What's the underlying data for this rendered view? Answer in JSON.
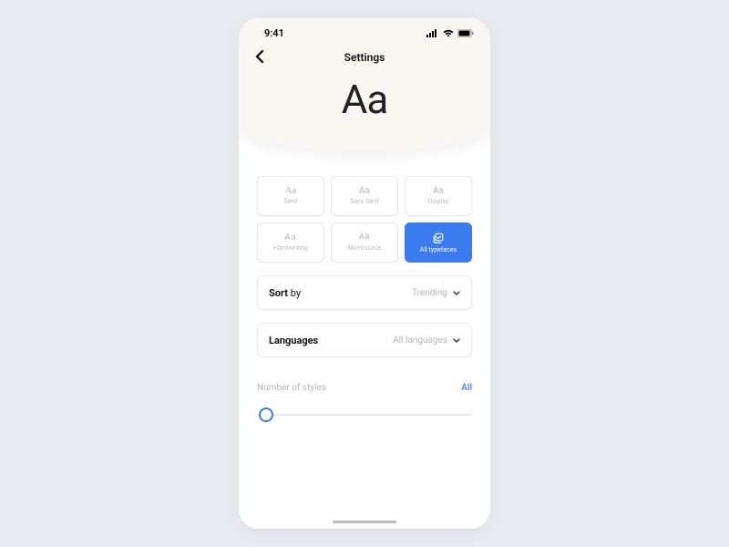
{
  "status": {
    "time": "9:41"
  },
  "nav": {
    "title": "Settings"
  },
  "hero": {
    "sample": "Aa"
  },
  "categories": [
    {
      "icon": "Aa",
      "label": "Serif",
      "style": "serif",
      "active": false
    },
    {
      "icon": "Aa",
      "label": "Sans Serif",
      "style": "sans",
      "active": false
    },
    {
      "icon": "Aa",
      "label": "Display",
      "style": "display",
      "active": false
    },
    {
      "icon": "Aa",
      "label": "Handwriting",
      "style": "hand",
      "active": false
    },
    {
      "icon": "Aa",
      "label": "Monospace",
      "style": "mono",
      "active": false
    },
    {
      "icon": "check",
      "label": "All typefaces",
      "style": "all",
      "active": true
    }
  ],
  "sort": {
    "label_bold": "Sort",
    "label_rest": " by",
    "value": "Trending"
  },
  "languages": {
    "label": "Languages",
    "value": "All languages"
  },
  "styles": {
    "label": "Number of styles",
    "all_label": "All"
  }
}
